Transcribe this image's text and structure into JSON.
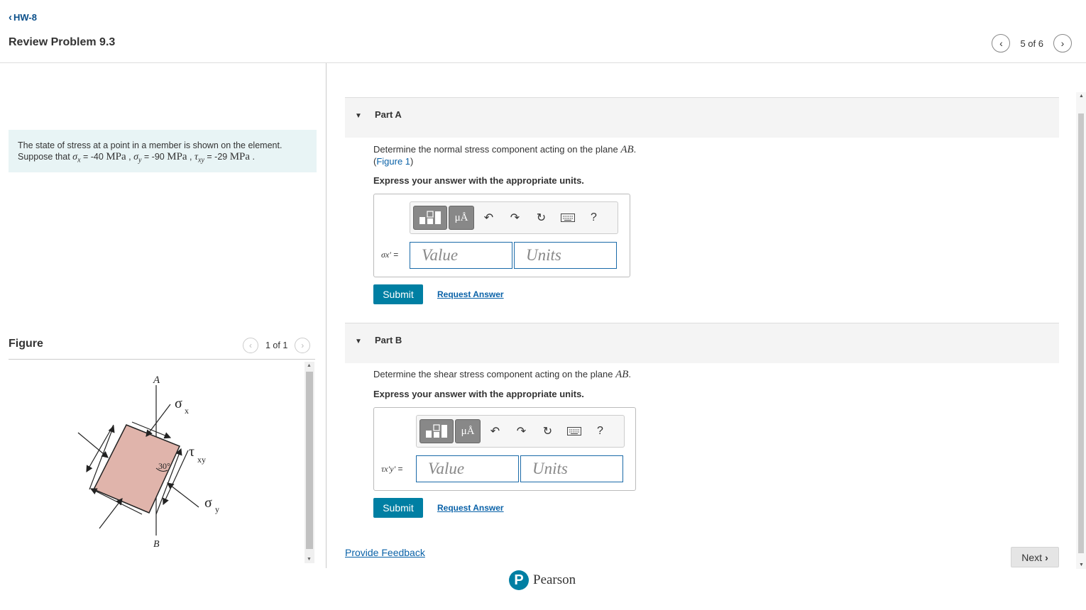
{
  "header": {
    "back_label": "HW-8",
    "title": "Review Problem 9.3",
    "pager_text": "5 of 6"
  },
  "problem": {
    "line1": "The state of stress at a point in a member is shown on the element.",
    "suppose": "Suppose that",
    "sx_sym": "σ",
    "sx_sub": "x",
    "sx_val": " = -40 ",
    "sy_sym": "σ",
    "sy_sub": "y",
    "sy_val": " = -90 ",
    "txy_sym": "τ",
    "txy_sub": "xy",
    "txy_val": " = -29 ",
    "unit": "MPa",
    "sep": " , ",
    "end": " ."
  },
  "figure": {
    "heading": "Figure",
    "pager_text": "1 of 1",
    "label_A": "A",
    "label_B": "B",
    "label_angle": "30°",
    "label_sigma": "σ",
    "label_tau": "τ",
    "sub_x": "x",
    "sub_y": "y",
    "sub_xy": "xy"
  },
  "partA": {
    "label": "Part A",
    "question": "Determine the normal stress component acting on the plane ",
    "plane": "AB",
    "period": ".",
    "figure_link_open": "(",
    "figure_link": "Figure 1",
    "figure_link_close": ")",
    "express": "Express your answer with the appropriate units.",
    "eq_label": "σx′",
    "eq_sign": " =",
    "value_placeholder": "Value",
    "units_placeholder": "Units",
    "submit": "Submit",
    "request": "Request Answer"
  },
  "partB": {
    "label": "Part B",
    "question": "Determine the shear stress component acting on the plane ",
    "plane": "AB",
    "period": ".",
    "express": "Express your answer with the appropriate units.",
    "eq_label": "τx′y′",
    "eq_sign": " =",
    "value_placeholder": "Value",
    "units_placeholder": "Units",
    "submit": "Submit",
    "request": "Request Answer"
  },
  "toolbar": {
    "mu_label": "μÅ",
    "help_label": "?"
  },
  "footer": {
    "feedback": "Provide Feedback",
    "next": "Next",
    "brand": "Pearson",
    "brand_initial": "P"
  },
  "colors": {
    "accent": "#007fa3",
    "link": "#0a62a8",
    "problem_bg": "#e8f4f5",
    "element_fill": "#e0b4ab"
  },
  "icons": [
    "chevron-left-icon",
    "chevron-right-icon",
    "caret-down-icon",
    "templates-icon",
    "undo-icon",
    "redo-icon",
    "reset-icon",
    "keyboard-icon",
    "help-icon",
    "pearson-logo"
  ]
}
